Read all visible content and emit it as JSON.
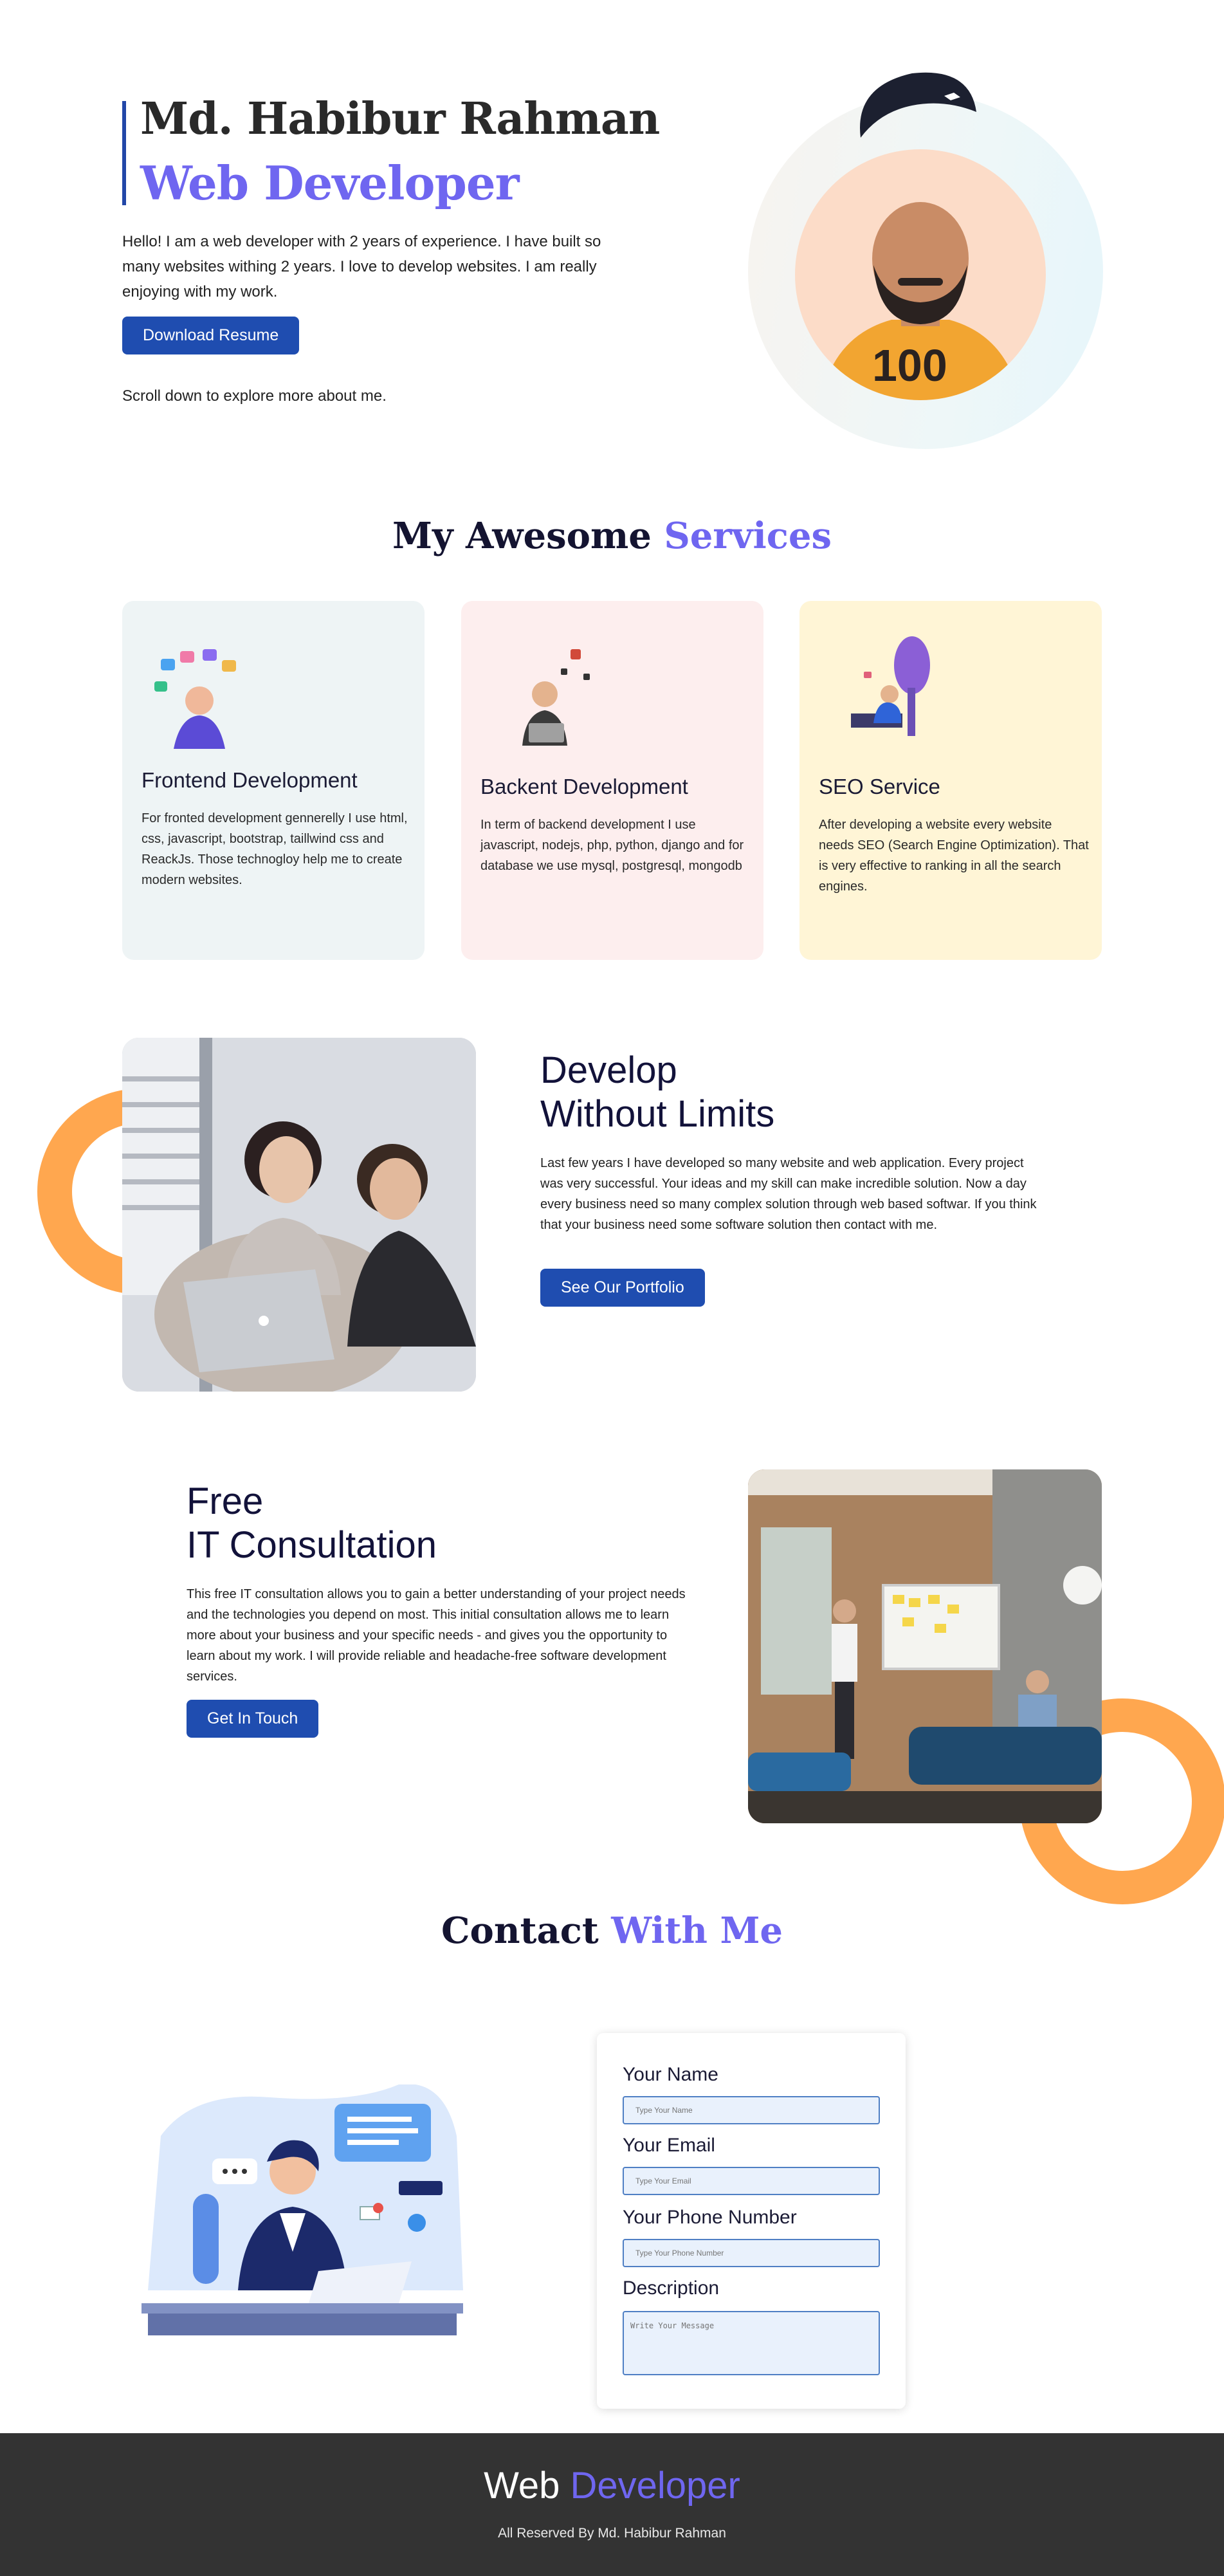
{
  "hero": {
    "name": "Md. Habibur Rahman",
    "role": "Web Developer",
    "intro": "Hello! I am a web developer with 2 years of experience. I have built so many websites withing 2 years. I love to develop websites. I am really enjoying with my work.",
    "download_label": "Download Resume",
    "scroll_hint": "Scroll down to explore more about me."
  },
  "services": {
    "title_a": "My Awesome ",
    "title_b": "Services",
    "cards": [
      {
        "title": "Frontend Development",
        "desc": "For fronted development gennerelly I use html, css, javascript, bootstrap, taillwind css and ReackJs. Those technogloy help me to create modern websites.",
        "bg": "#eef4f5",
        "icon": "frontend-illustration"
      },
      {
        "title": "Backent Development",
        "desc": "In term of backend development I use javascript, nodejs, php, python, django and for database we use mysql, postgresql, mongodb",
        "bg": "#fdeeee",
        "icon": "backend-illustration"
      },
      {
        "title": "SEO Service",
        "desc": "After developing a website every website needs SEO (Search Engine Optimization). That is very effective to ranking in all the search engines.",
        "bg": "#fff5d6",
        "icon": "seo-illustration"
      }
    ]
  },
  "develop": {
    "title_line1": "Develop",
    "title_line2": "Without Limits",
    "text": "Last few years I have developed so many website and web application. Every project was very successful. Your ideas and my skill can make incredible solution. Now a day every business need so many complex solution through web based softwar. If you think that your business need some software solution then contact with me.",
    "button": "See Our Portfolio"
  },
  "consult": {
    "title_line1": "Free",
    "title_line2": "IT Consultation",
    "text": "This free IT consultation allows you to gain a better understanding of your project needs and the technologies you depend on most. This initial consultation allows me to learn more about your business and your specific needs - and gives you the opportunity to learn about my work. I will provide reliable and headache-free software development services.",
    "button": "Get In Touch"
  },
  "contact": {
    "title_a": "Contact ",
    "title_b": "With Me",
    "form": {
      "name_label": "Your Name",
      "name_placeholder": "Type Your Name",
      "email_label": "Your Email",
      "email_placeholder": "Type Your Email",
      "phone_label": "Your Phone Number",
      "phone_placeholder": "Type Your Phone Number",
      "desc_label": "Description",
      "desc_placeholder": "Write Your Message"
    }
  },
  "footer": {
    "brand_a": "Web ",
    "brand_b": "Developer",
    "rights": "All Reserved By Md. Habibur Rahman"
  },
  "colors": {
    "accent": "#6f66f0",
    "button": "#1f4db0",
    "orange": "#ffa74f",
    "footer_bg": "#333333"
  }
}
